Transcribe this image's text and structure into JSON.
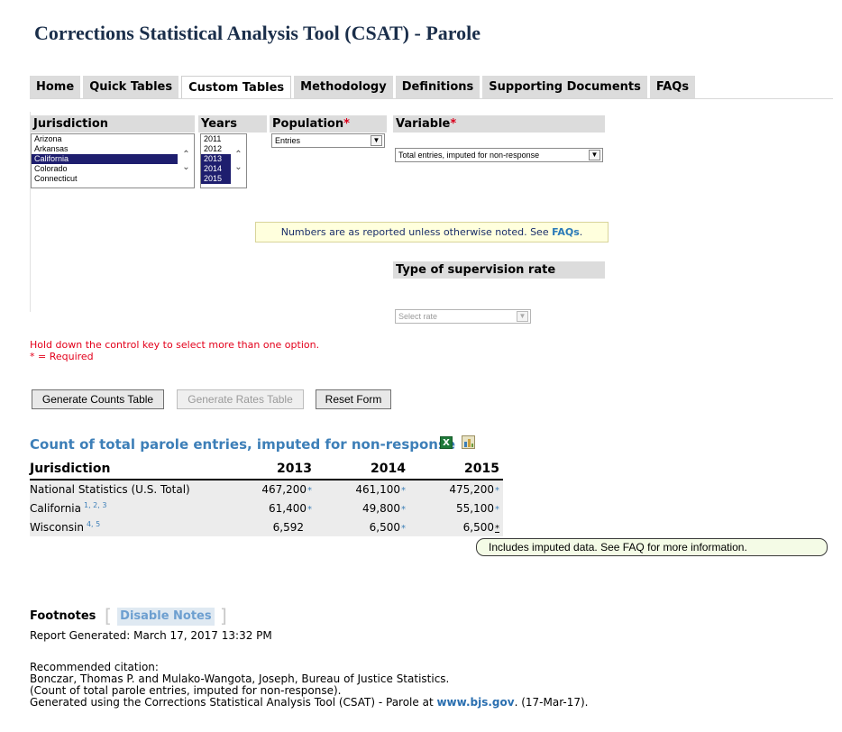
{
  "page": {
    "title": "Corrections Statistical Analysis Tool (CSAT) - Parole"
  },
  "tabs": [
    {
      "label": "Home",
      "active": false
    },
    {
      "label": "Quick Tables",
      "active": false
    },
    {
      "label": "Custom Tables",
      "active": true
    },
    {
      "label": "Methodology",
      "active": false
    },
    {
      "label": "Definitions",
      "active": false
    },
    {
      "label": "Supporting Documents",
      "active": false
    },
    {
      "label": "FAQs",
      "active": false
    }
  ],
  "form": {
    "jurisdiction": {
      "label": "Jurisdiction",
      "options": [
        "Arizona",
        "Arkansas",
        "California",
        "Colorado",
        "Connecticut"
      ],
      "selected": [
        "California"
      ]
    },
    "years": {
      "label": "Years",
      "options": [
        "2011",
        "2012",
        "2013",
        "2014",
        "2015"
      ],
      "selected": [
        "2013",
        "2014",
        "2015"
      ]
    },
    "population": {
      "label": "Population",
      "required_mark": "*",
      "value": "Entries"
    },
    "variable": {
      "label": "Variable",
      "required_mark": "*",
      "value": "Total entries, imputed for non-response"
    },
    "note": {
      "text": "Numbers are as reported unless otherwise noted. See ",
      "link": "FAQs",
      "end": "."
    },
    "rate_type": {
      "label": "Type of supervision rate",
      "placeholder": "Select rate"
    },
    "hint_line1": "Hold down the control key to select more than one option.",
    "hint_line2": "* = Required",
    "buttons": {
      "counts": "Generate Counts Table",
      "rates": "Generate Rates Table",
      "reset": "Reset Form"
    }
  },
  "result": {
    "title": "Count of total parole entries, imputed for non-response",
    "icons": [
      "excel-export-icon",
      "chart-icon"
    ],
    "columns": [
      "Jurisdiction",
      "2013",
      "2014",
      "2015"
    ],
    "rows": [
      {
        "name": "National Statistics (U.S. Total)",
        "notes": "",
        "values": [
          "467,200",
          "461,100",
          "475,200"
        ],
        "marks": [
          "*",
          "*",
          "*"
        ]
      },
      {
        "name": "California",
        "notes": "1, 2, 3",
        "values": [
          "61,400",
          "49,800",
          "55,100"
        ],
        "marks": [
          "*",
          "*",
          "*"
        ]
      },
      {
        "name": "Wisconsin",
        "notes": "4, 5",
        "values": [
          "6,592",
          "6,500",
          "6,500"
        ],
        "marks": [
          "",
          "*",
          "*"
        ]
      }
    ],
    "callout": "Includes imputed data. See FAQ for more information."
  },
  "footer": {
    "footnotes_label": "Footnotes",
    "disable_notes": "Disable Notes",
    "report_generated": "Report Generated: March 17, 2017 13:32 PM",
    "citation": {
      "heading": "Recommended citation:",
      "line1": "Bonczar, Thomas P. and Mulako-Wangota, Joseph, Bureau of Justice Statistics.",
      "line2": "(Count of total parole entries, imputed for non-response).",
      "line3_prefix": "Generated using the Corrections Statistical Analysis Tool (CSAT) - Parole at ",
      "line3_link": "www.bjs.gov",
      "line3_suffix": ". (17-Mar-17)."
    }
  },
  "colors": {
    "title": "#1a2e4a",
    "tab_bg": "#dcdcdc",
    "selection": "#1e1e6e",
    "required": "#d9001b",
    "link": "#3d7fb8",
    "note_bg": "#ffffdd",
    "callout_bg": "#f4fbe6"
  }
}
